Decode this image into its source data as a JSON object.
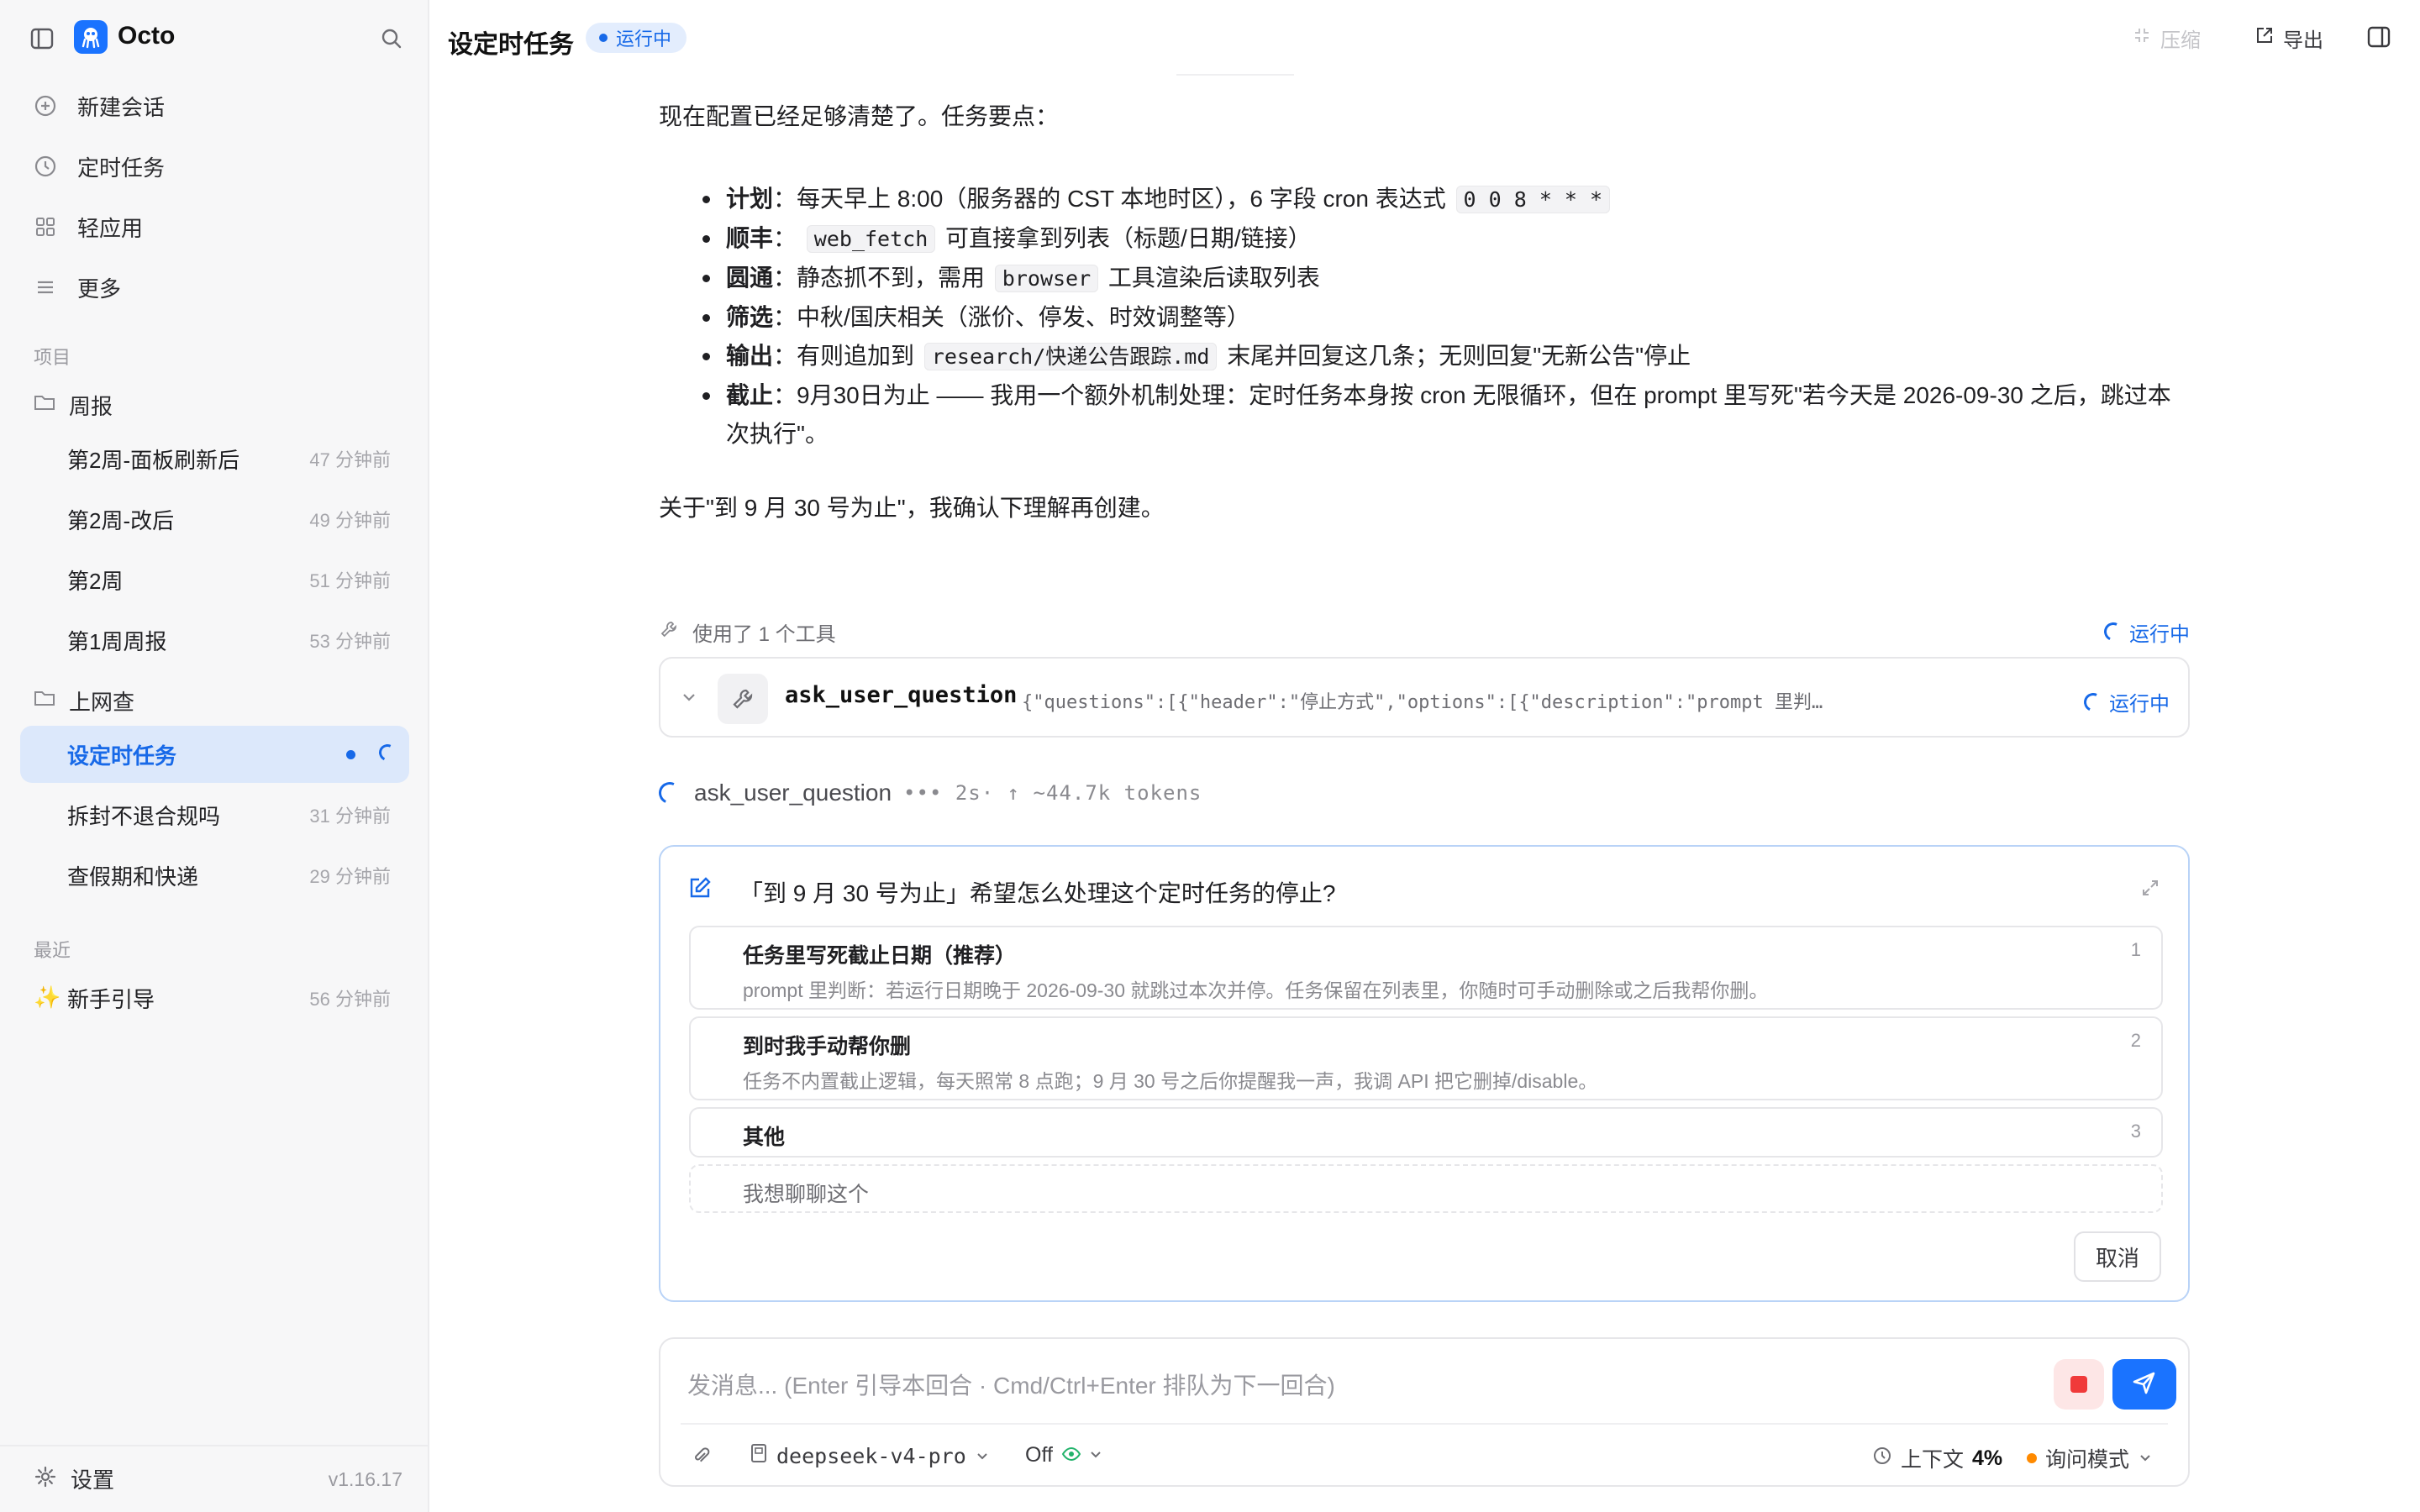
{
  "app": {
    "name": "Octo",
    "version": "v1.16.17"
  },
  "sidebar": {
    "nav": [
      {
        "label": "新建会话",
        "icon": "plus-circle-icon"
      },
      {
        "label": "定时任务",
        "icon": "clock-icon"
      },
      {
        "label": "轻应用",
        "icon": "grid-icon"
      },
      {
        "label": "更多",
        "icon": "menu-icon"
      }
    ],
    "projects_label": "项目",
    "groups": [
      {
        "title": "周报",
        "items": [
          {
            "title": "第2周-面板刷新后",
            "time": "47 分钟前"
          },
          {
            "title": "第2周-改后",
            "time": "49 分钟前"
          },
          {
            "title": "第2周",
            "time": "51 分钟前"
          },
          {
            "title": "第1周周报",
            "time": "53 分钟前"
          }
        ]
      },
      {
        "title": "上网查",
        "items": [
          {
            "title": "设定时任务",
            "time": "",
            "active": true
          },
          {
            "title": "拆封不退合规吗",
            "time": "31 分钟前"
          },
          {
            "title": "查假期和快递",
            "time": "29 分钟前"
          }
        ]
      }
    ],
    "recent_label": "最近",
    "recent": [
      {
        "title": "新手引导",
        "time": "56 分钟前",
        "icon": "sparkle-icon"
      }
    ],
    "settings_label": "设置"
  },
  "header": {
    "title": "设定时任务",
    "status": "运行中",
    "compress_label": "压缩",
    "export_label": "导出"
  },
  "message": {
    "intro": "现在配置已经足够清楚了。任务要点：",
    "bullets": [
      {
        "key": "计划",
        "parts": [
          "：每天早上 8:00（服务器的 CST 本地时区），6 字段 cron 表达式 ",
          "0 0 8 * * *",
          ""
        ]
      },
      {
        "key": "顺丰",
        "parts": [
          "： ",
          "web_fetch",
          " 可直接拿到列表（标题/日期/链接）"
        ]
      },
      {
        "key": "圆通",
        "parts": [
          "：静态抓不到，需用 ",
          "browser",
          " 工具渲染后读取列表"
        ]
      },
      {
        "key": "筛选",
        "parts": [
          "：中秋/国庆相关（涨价、停发、时效调整等）",
          "",
          ""
        ]
      },
      {
        "key": "输出",
        "parts": [
          "：有则追加到 ",
          "research/快递公告跟踪.md",
          " 末尾并回复这几条；无则回复\"无新公告\"停止"
        ]
      },
      {
        "key": "截止",
        "line1": "：9月30日为止 —— 我用一个额外机制处理：定时任务本身按 cron 无限循环，但在 prompt 里写死\"若今天是 2026-09-30 之后，跳过本",
        "line2": "次执行\"。"
      }
    ],
    "closing": "关于\"到 9 月 30 号为止\"，我确认下理解再创建。"
  },
  "tools": {
    "used_label": "使用了 1 个工具",
    "status": "运行中",
    "call": {
      "name": "ask_user_question",
      "args": "{\"questions\":[{\"header\":\"停止方式\",\"options\":[{\"description\":\"prompt 里判断：若运行日期晚于 …",
      "status": "运行中"
    },
    "progress": {
      "name": "ask_user_question",
      "stats": "••• 2s· ↑ ~44.7k tokens"
    }
  },
  "question": {
    "text": "「到 9 月 30 号为止」希望怎么处理这个定时任务的停止?",
    "options": [
      {
        "label": "任务里写死截止日期（推荐）",
        "desc": "prompt 里判断：若运行日期晚于 2026-09-30 就跳过本次并停。任务保留在列表里，你随时可手动删除或之后我帮你删。",
        "num": "1"
      },
      {
        "label": "到时我手动帮你删",
        "desc": "任务不内置截止逻辑，每天照常 8 点跑；9 月 30 号之后你提醒我一声，我调 API 把它删掉/disable。",
        "num": "2"
      },
      {
        "label": "其他",
        "desc": "",
        "num": "3"
      }
    ],
    "chat_option": "我想聊聊这个",
    "cancel_label": "取消"
  },
  "composer": {
    "placeholder": "发消息... (Enter 引导本回合 · Cmd/Ctrl+Enter 排队为下一回合)",
    "model": "deepseek-v4-pro",
    "toggle": "Off",
    "context_label": "上下文",
    "context_value": "4%",
    "mode": "询问模式"
  },
  "colors": {
    "accent": "#1a73ff",
    "active_bg": "#dce8fb",
    "stop": "#f03a3a",
    "mode_dot": "#ff8a00"
  }
}
